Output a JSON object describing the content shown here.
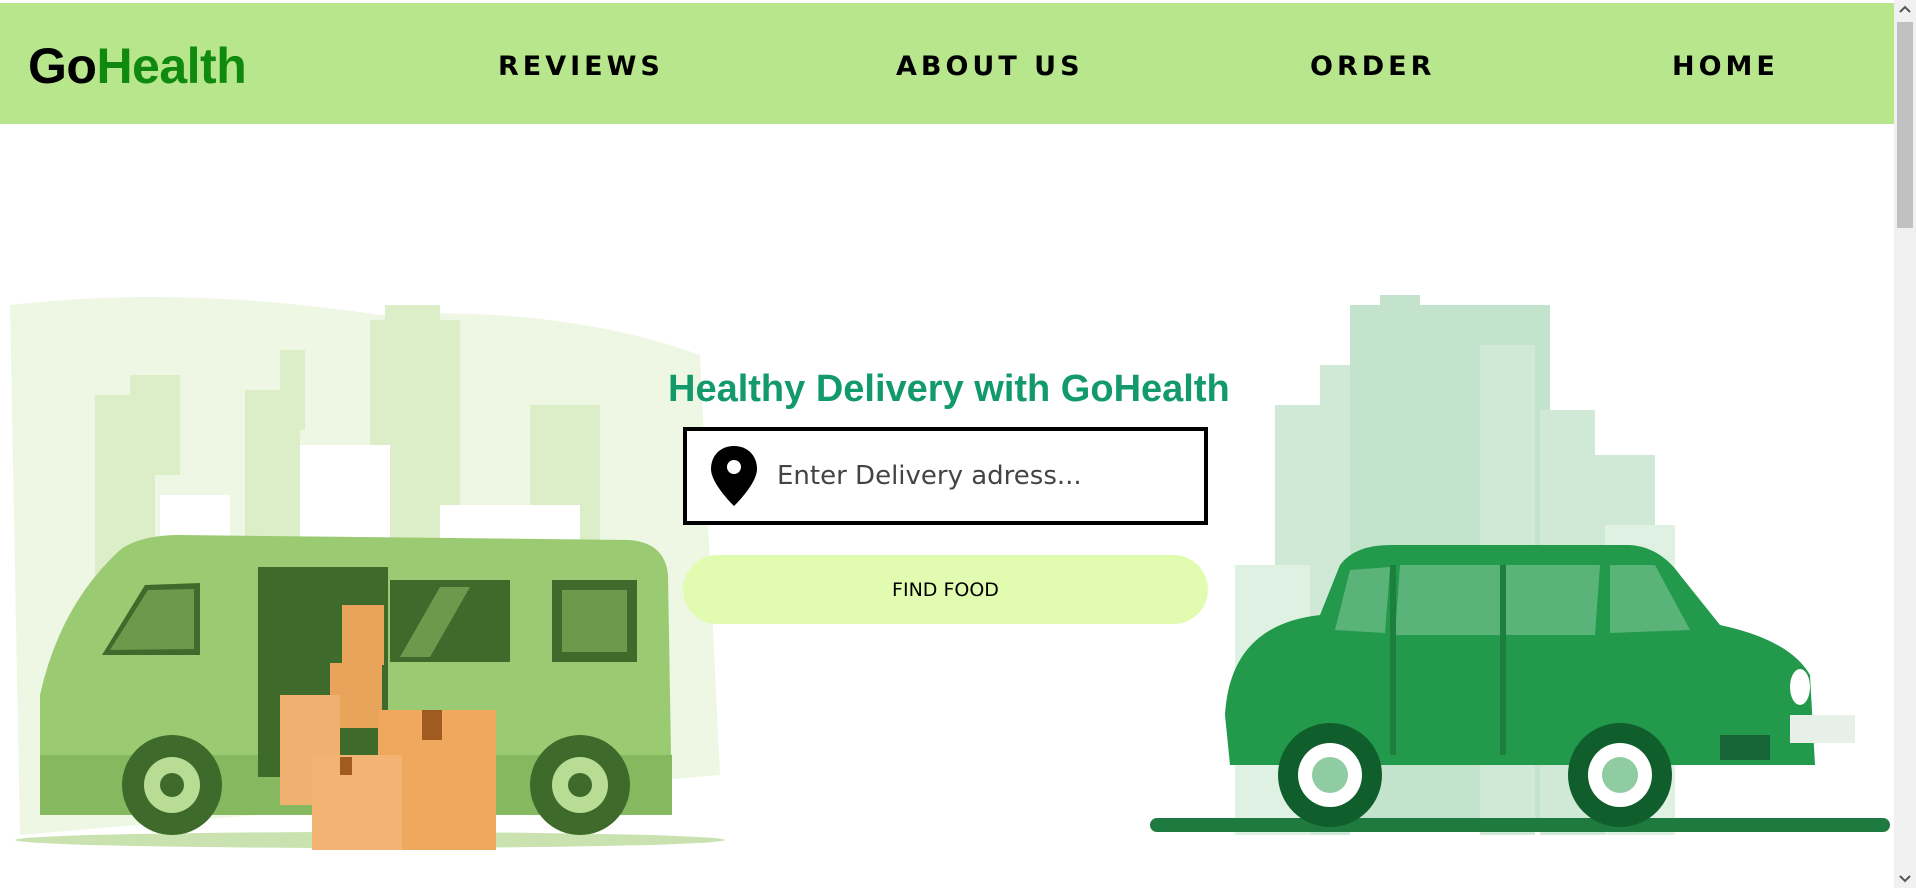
{
  "navbar": {
    "logo_part1": "Go",
    "logo_part2": "Health",
    "links": [
      {
        "label": "REVIEWS"
      },
      {
        "label": "ABOUT US"
      },
      {
        "label": "ORDER"
      },
      {
        "label": "HOME"
      }
    ]
  },
  "hero": {
    "title": "Healthy Delivery with GoHealth",
    "address_placeholder": "Enter Delivery adress...",
    "address_value": "",
    "find_button_label": "FIND FOOD"
  },
  "icons": {
    "location": "location-pin-icon",
    "van": "delivery-van-illustration",
    "car": "green-car-illustration"
  },
  "colors": {
    "navbar_bg": "#b8e68c",
    "logo_accent": "#0f8a0f",
    "title": "#139a6b",
    "button_bg": "#e1fcb0"
  }
}
